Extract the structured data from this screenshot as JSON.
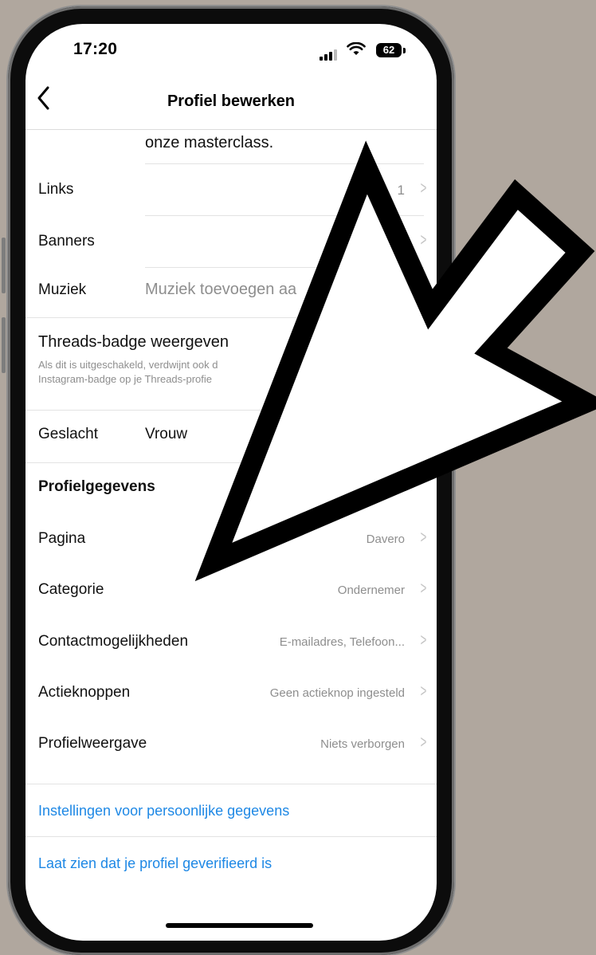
{
  "status": {
    "time": "17:20",
    "battery": "62"
  },
  "nav": {
    "title": "Profiel bewerken",
    "back_icon": "chevron-left-icon"
  },
  "bio_fragment": "onze masterclass.",
  "rows": {
    "links": {
      "label": "Links",
      "value": "1"
    },
    "banners": {
      "label": "Banners",
      "value": ""
    },
    "muziek": {
      "label": "Muziek",
      "value": "Muziek toevoegen aa"
    },
    "threads": {
      "title": "Threads-badge weergeven",
      "desc_line1": "Als dit is uitgeschakeld, verdwijnt ook d",
      "desc_line2": "Instagram-badge op je Threads-profie"
    },
    "geslacht": {
      "label": "Geslacht",
      "value": "Vrouw"
    }
  },
  "profile_section": {
    "heading": "Profielgegevens",
    "items": [
      {
        "label": "Pagina",
        "value": "Davero"
      },
      {
        "label": "Categorie",
        "value": "Ondernemer"
      },
      {
        "label": "Contactmogelijkheden",
        "value": "E-mailadres, Telefoon..."
      },
      {
        "label": "Actieknoppen",
        "value": "Geen actieknop ingesteld"
      },
      {
        "label": "Profielweergave",
        "value": "Niets verborgen"
      }
    ]
  },
  "links": {
    "personal_settings": "Instellingen voor persoonlijke gegevens",
    "verify": "Laat zien dat je profiel geverifieerd is"
  },
  "colors": {
    "background": "#b0a79e",
    "link": "#1e88e5",
    "arrow_fill": "#ffffff",
    "arrow_stroke": "#000000"
  }
}
